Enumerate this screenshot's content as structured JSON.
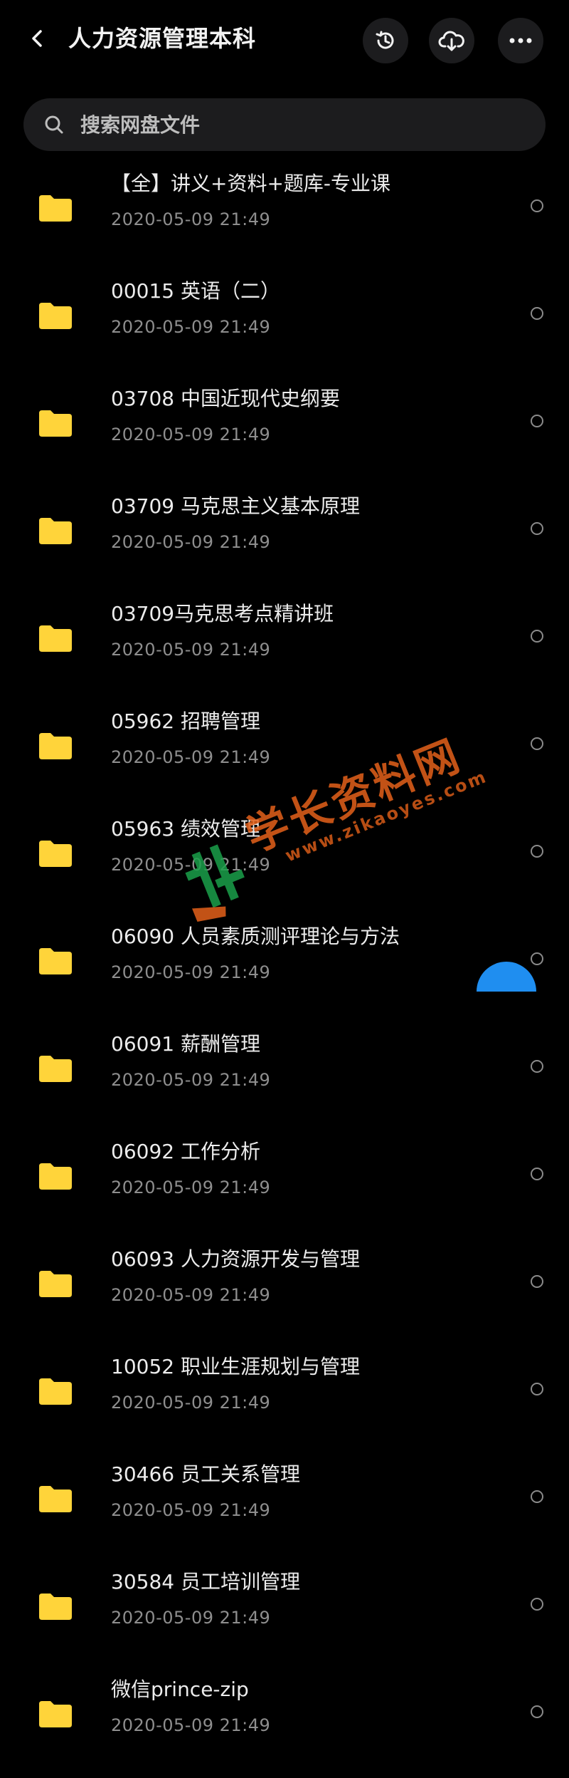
{
  "header": {
    "title": "人力资源管理本科",
    "icons": [
      "back-arrow-icon",
      "history-icon",
      "cloud-download-icon",
      "more-icon"
    ]
  },
  "search": {
    "placeholder": "搜索网盘文件"
  },
  "colors": {
    "background": "#000000",
    "folder": "#ffd43a",
    "accent": "#1f8ef0",
    "watermark": "#e4611a"
  },
  "files": [
    {
      "name": "【全】讲义+资料+题库-专业课",
      "date": "2020-05-09  21:49"
    },
    {
      "name": "00015 英语（二）",
      "date": "2020-05-09  21:49"
    },
    {
      "name": "03708 中国近现代史纲要",
      "date": "2020-05-09  21:49"
    },
    {
      "name": "03709 马克思主义基本原理",
      "date": "2020-05-09  21:49"
    },
    {
      "name": "03709马克思考点精讲班",
      "date": "2020-05-09  21:49"
    },
    {
      "name": "05962 招聘管理",
      "date": "2020-05-09  21:49"
    },
    {
      "name": "05963 绩效管理",
      "date": "2020-05-09  21:49"
    },
    {
      "name": "06090 人员素质测评理论与方法",
      "date": "2020-05-09  21:49"
    },
    {
      "name": "06091 薪酬管理",
      "date": "2020-05-09  21:49"
    },
    {
      "name": "06092 工作分析",
      "date": "2020-05-09  21:49"
    },
    {
      "name": "06093 人力资源开发与管理",
      "date": "2020-05-09  21:49"
    },
    {
      "name": "10052 职业生涯规划与管理",
      "date": "2020-05-09  21:49"
    },
    {
      "name": "30466 员工关系管理",
      "date": "2020-05-09  21:49"
    },
    {
      "name": "30584 员工培训管理",
      "date": "2020-05-09  21:49"
    },
    {
      "name": "微信prince-zip",
      "date": "2020-05-09  21:49"
    }
  ],
  "watermark": {
    "text": "学长资料网",
    "url": "www.zikaoyes.com"
  }
}
